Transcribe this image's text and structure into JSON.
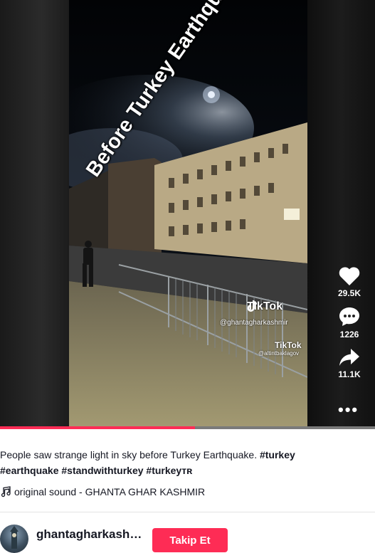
{
  "video": {
    "overlay_text": "Before Turkey Earthquake",
    "watermark_primary": {
      "brand": "TikTok",
      "user": "@ghantagharkashmir"
    },
    "watermark_secondary": {
      "brand": "TikTok",
      "user": "@altintbaklagov"
    },
    "progress_fraction": 0.52
  },
  "actions": {
    "likes": "29.5K",
    "comments": "1226",
    "shares": "11.1K",
    "more": "•••"
  },
  "caption": {
    "text": "People saw strange light in sky before Turkey Earthquake. ",
    "tags": [
      "#turkey",
      "#earthquake",
      "#standwithturkey",
      "#turkeyᴛʀ"
    ]
  },
  "music": {
    "label": "original sound - GHANTA GHAR KASHMIR"
  },
  "author": {
    "username": "ghantagharkashmir",
    "follow_label": "Takip Et"
  },
  "colors": {
    "accent": "#fe2c55",
    "text": "#161823"
  }
}
